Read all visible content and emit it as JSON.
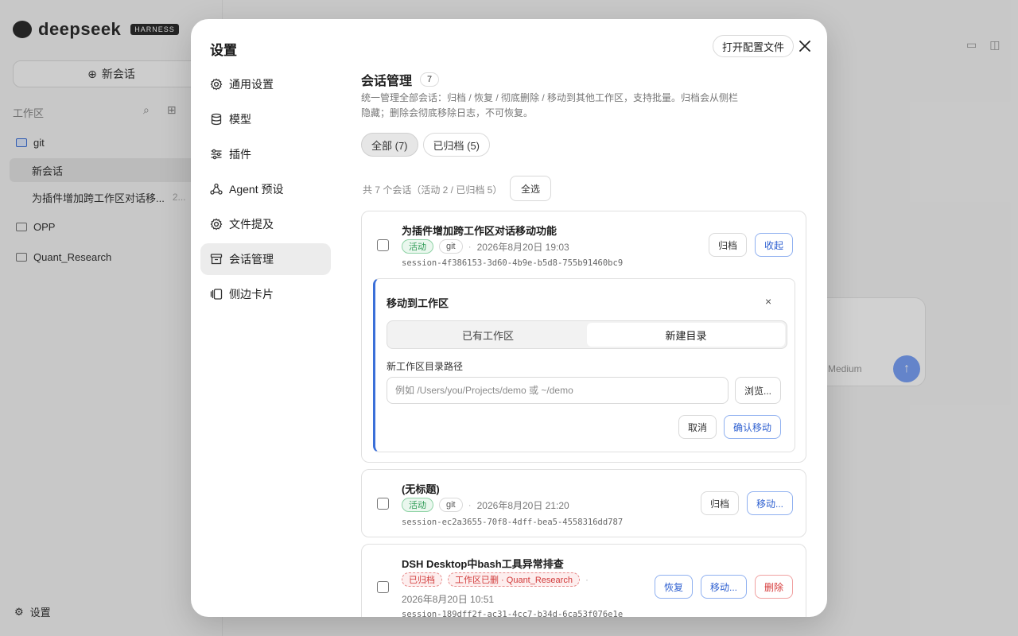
{
  "app": {
    "logo_text": "deepseek",
    "logo_badge": "HARNESS",
    "new_chat": "新会话",
    "workspace_label": "工作区",
    "workspaces": [
      {
        "name": "git"
      },
      {
        "name": "OPP"
      },
      {
        "name": "Quant_Research"
      }
    ],
    "sessions": [
      {
        "title": "新会话"
      },
      {
        "title": "为插件增加跨工作区对话移...",
        "date_stub": "2..."
      }
    ],
    "settings_label": "设置",
    "model_label": "Medium"
  },
  "modal": {
    "title": "设置",
    "open_config": "打开配置文件",
    "nav": [
      {
        "label": "通用设置",
        "icon": "gear-icon"
      },
      {
        "label": "模型",
        "icon": "database-icon"
      },
      {
        "label": "插件",
        "icon": "sliders-icon"
      },
      {
        "label": "Agent 预设",
        "icon": "agent-icon"
      },
      {
        "label": "文件提及",
        "icon": "gear-icon"
      },
      {
        "label": "会话管理",
        "icon": "archive-icon",
        "active": true
      },
      {
        "label": "侧边卡片",
        "icon": "cards-icon"
      }
    ]
  },
  "session_mgmt": {
    "title": "会话管理",
    "count": "7",
    "description": "统一管理全部会话：归档 / 恢复 / 彻底删除 / 移动到其他工作区，支持批量。归档会从侧栏隐藏；删除会彻底移除日志，不可恢复。",
    "tabs": [
      {
        "label": "全部 (7)",
        "active": true
      },
      {
        "label": "已归档 (5)",
        "active": false
      }
    ],
    "summary": "共 7 个会话（活动 2 / 已归档 5）",
    "select_all": "全选",
    "sessions": [
      {
        "title": "为插件增加跨工作区对话移动功能",
        "status": "活动",
        "workspace": "git",
        "time": "2026年8月20日 19:03",
        "id": "session-4f386153-3d60-4b9e-b5d8-755b91460bc9",
        "actions": [
          "归档",
          "收起"
        ]
      },
      {
        "title": "(无标题)",
        "status": "活动",
        "workspace": "git",
        "time": "2026年8月20日 21:20",
        "id": "session-ec2a3655-70f8-4dff-bea5-4558316dd787",
        "actions": [
          "归档",
          "移动..."
        ]
      },
      {
        "title": "DSH Desktop中bash工具异常排查",
        "status": "已归档",
        "workspace": "工作区已删 · Quant_Research",
        "time": "2026年8月20日 10:51",
        "id": "session-189dff2f-ac31-4cc7-b34d-6ca53f076e1e",
        "actions": [
          "恢复",
          "移动...",
          "删除"
        ]
      }
    ],
    "move_panel": {
      "title": "移动到工作区",
      "close": "×",
      "tabs": [
        {
          "label": "已有工作区",
          "active": false
        },
        {
          "label": "新建目录",
          "active": true
        }
      ],
      "path_label": "新工作区目录路径",
      "path_placeholder": "例如 /Users/you/Projects/demo 或 ~/demo",
      "browse": "浏览...",
      "cancel": "取消",
      "confirm": "确认移动"
    }
  },
  "colors": {
    "accent": "#3b6fd8",
    "active_green": "#2e9b55",
    "danger_red": "#d63a3a"
  }
}
